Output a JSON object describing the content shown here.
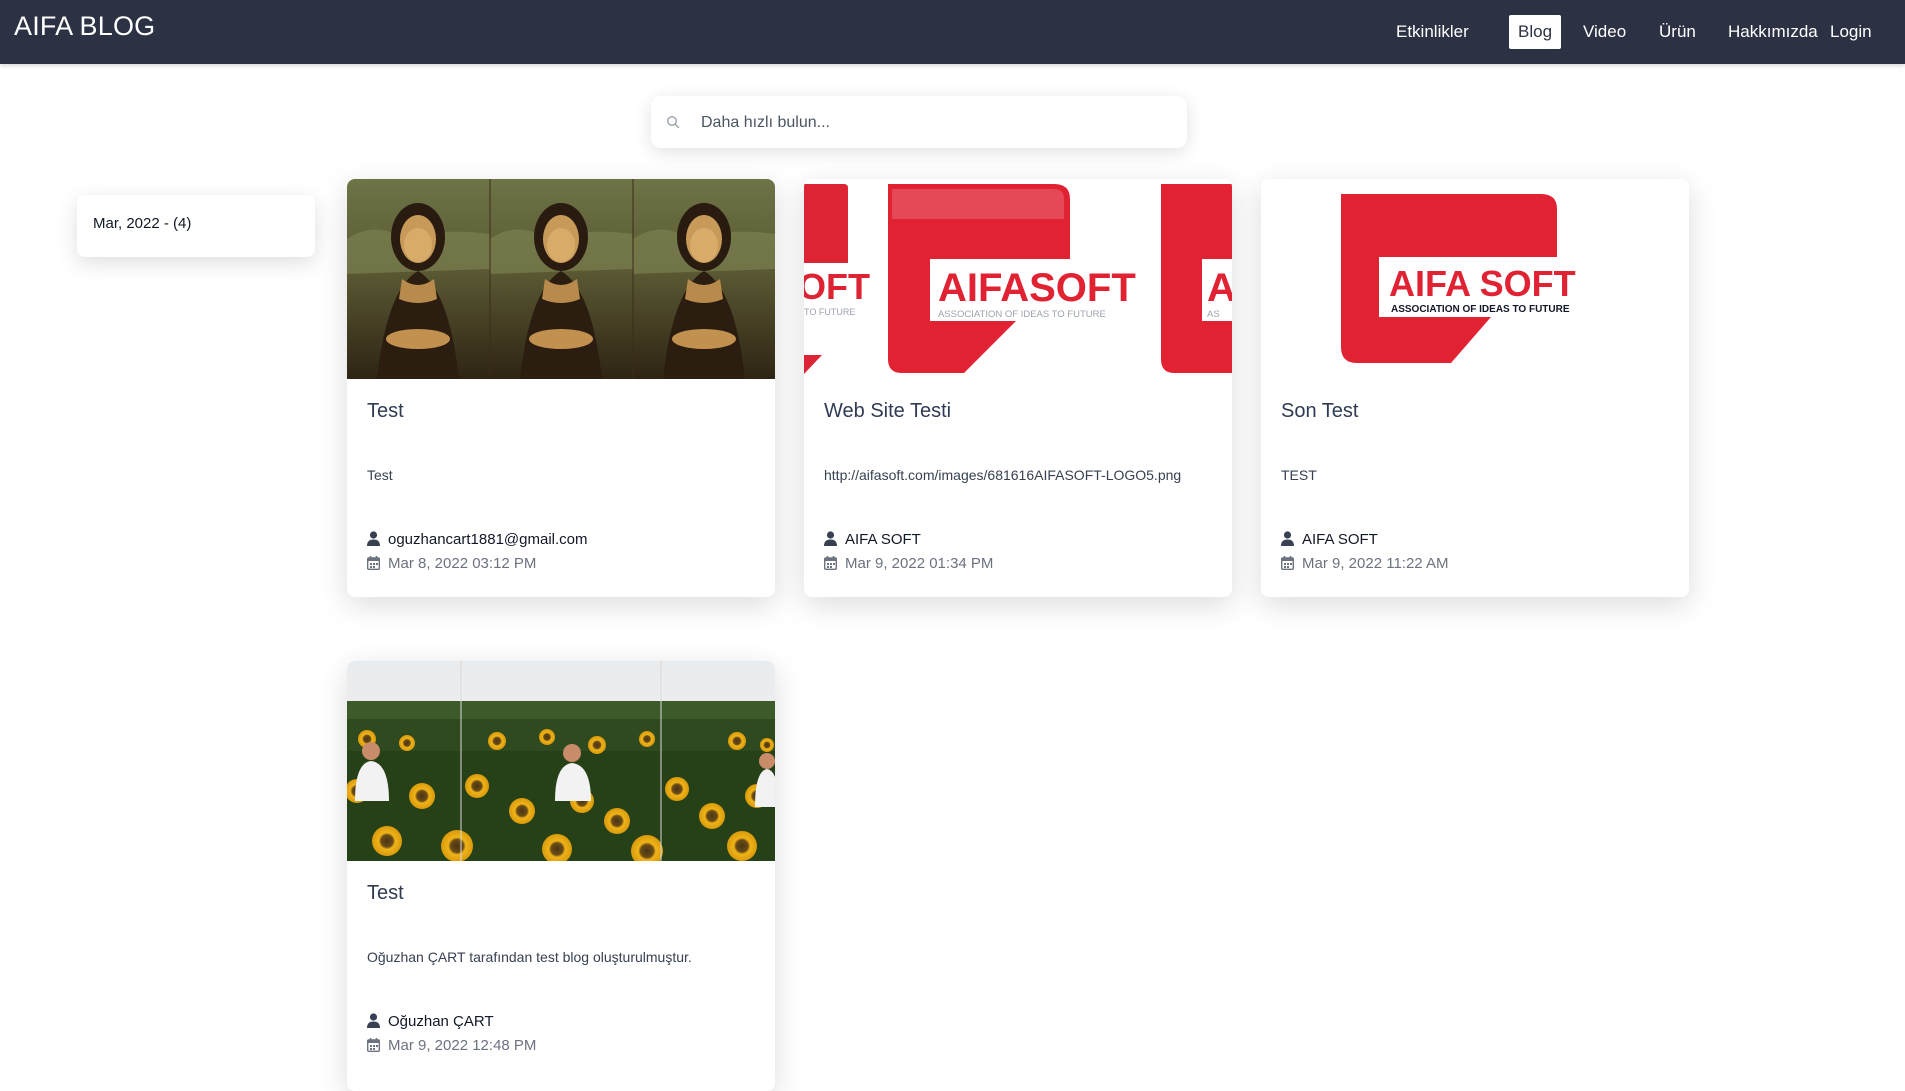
{
  "header": {
    "brand": "AIFA BLOG",
    "nav": [
      "Etkinlikler",
      "Blog",
      "Video",
      "Ürün",
      "Hakkımızda",
      "Login"
    ],
    "active": "Blog"
  },
  "search": {
    "placeholder": "Daha hızlı bulun..."
  },
  "archive": {
    "label": "Mar, 2022 - (4)"
  },
  "posts": [
    {
      "title": "Test",
      "description": "Test",
      "author": "oguzhancart1881@gmail.com",
      "date": "Mar 8, 2022 03:12 PM",
      "image": "mona-lisa"
    },
    {
      "title": "Web Site Testi",
      "description": "http://aifasoft.com/images/681616AIFASOFT-LOGO5.png",
      "author": "AIFA SOFT",
      "date": "Mar 9, 2022 01:34 PM",
      "image": "aifasoft-logo"
    },
    {
      "title": "Son Test",
      "description": "TEST",
      "author": "AIFA SOFT",
      "date": "Mar 9, 2022 11:22 AM",
      "image": "aifa-soft-logo"
    },
    {
      "title": "Test",
      "description": "Oğuzhan ÇART tarafından test blog oluşturulmuştur.",
      "author": "Oğuzhan ÇART",
      "date": "Mar 9, 2022 12:48 PM",
      "image": "sunflower-field"
    }
  ],
  "logos": {
    "aifasoft": {
      "text": "AIFASOFT",
      "tagline": "ASSOCIATION OF IDEAS TO FUTURE",
      "left_fragment": "OFT",
      "left_tagline": "TO FUTURE",
      "right_fragment": "A",
      "right_tagline": "AS"
    },
    "aifa_soft": {
      "text": "AIFA SOFT",
      "tagline": "ASSOCIATION OF IDEAS TO FUTURE"
    }
  },
  "colors": {
    "navbar": "#2c3243",
    "brand_red": "#e02233",
    "title": "#2f3b52"
  }
}
